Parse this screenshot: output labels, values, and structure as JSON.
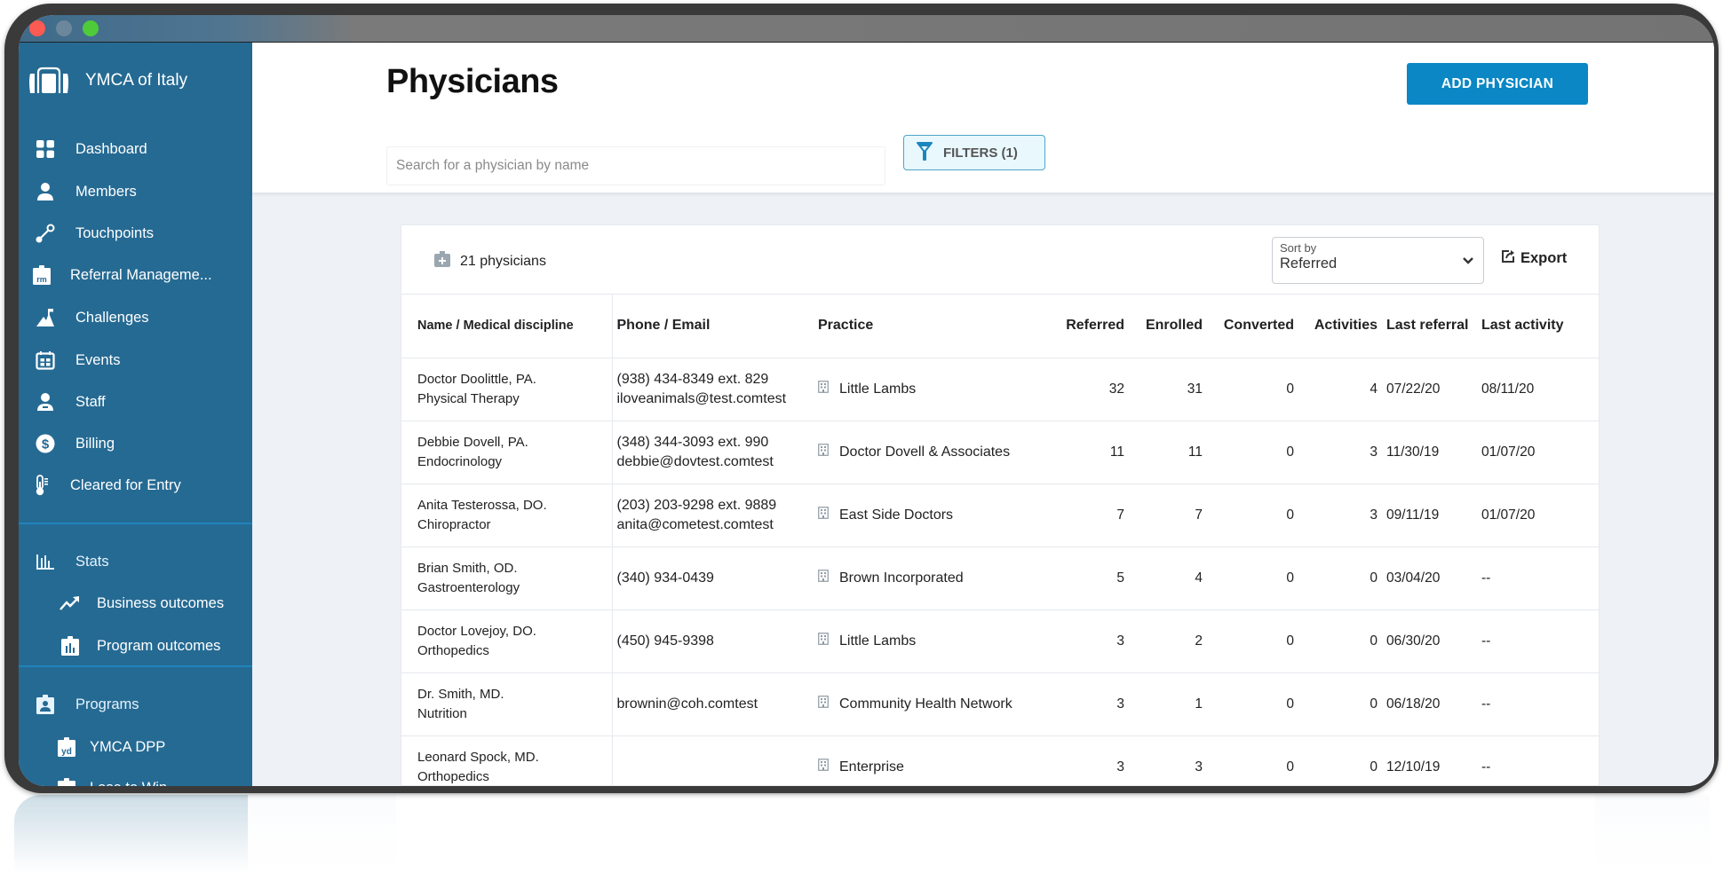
{
  "window": {
    "controls": [
      "close",
      "minimize",
      "zoom"
    ]
  },
  "sidebar": {
    "brand": "YMCA of Italy",
    "items": [
      {
        "label": "Dashboard",
        "icon": "dashboard-grid-icon"
      },
      {
        "label": "Members",
        "icon": "person-icon"
      },
      {
        "label": "Touchpoints",
        "icon": "touchpoints-link-icon"
      },
      {
        "label": "Referral Manageme...",
        "icon": "referral-management-rm-icon"
      },
      {
        "label": "Challenges",
        "icon": "mountain-flag-icon"
      },
      {
        "label": "Events",
        "icon": "calendar-icon"
      },
      {
        "label": "Staff",
        "icon": "staff-badge-icon"
      },
      {
        "label": "Billing",
        "icon": "dollar-circle-icon"
      },
      {
        "label": "Cleared for Entry",
        "icon": "thermometer-icon"
      }
    ],
    "stats": {
      "label": "Stats",
      "icon": "bar-chart-icon",
      "children": [
        {
          "label": "Business outcomes",
          "icon": "trend-up-icon"
        },
        {
          "label": "Program outcomes",
          "icon": "clipboard-chart-icon"
        }
      ]
    },
    "programs": {
      "label": "Programs",
      "icon": "clipboard-person-icon",
      "children": [
        {
          "label": "YMCA DPP",
          "icon": "clipboard-yd-icon"
        },
        {
          "label": "Lose to Win",
          "icon": "clipboard-lt-icon"
        }
      ]
    }
  },
  "header": {
    "title": "Physicians",
    "add_button": "ADD PHYSICIAN",
    "search_placeholder": "Search for a physician by name",
    "search_value": "",
    "filters_label": "FILTERS (1)"
  },
  "toolbar": {
    "count_label": "21 physicians",
    "sort_label": "Sort by",
    "sort_value": "Referred",
    "export_label": "Export"
  },
  "table": {
    "columns": [
      "Name / Medical discipline",
      "Phone / Email",
      "Practice",
      "Referred",
      "Enrolled",
      "Converted",
      "Activities",
      "Last referral",
      "Last activity"
    ],
    "rows": [
      {
        "name": "Doctor Doolittle, PA.",
        "discipline": "Physical Therapy",
        "phone": "(938) 434-8349 ext. 829",
        "email": "iloveanimals@test.comtest",
        "practice": "Little Lambs",
        "referred": "32",
        "enrolled": "31",
        "converted": "0",
        "activities": "4",
        "last_referral": "07/22/20",
        "last_activity": "08/11/20"
      },
      {
        "name": "Debbie Dovell, PA.",
        "discipline": "Endocrinology",
        "phone": "(348) 344-3093 ext. 990",
        "email": "debbie@dovtest.comtest",
        "practice": "Doctor Dovell & Associates",
        "referred": "11",
        "enrolled": "11",
        "converted": "0",
        "activities": "3",
        "last_referral": "11/30/19",
        "last_activity": "01/07/20"
      },
      {
        "name": "Anita Testerossa, DO.",
        "discipline": "Chiropractor",
        "phone": "(203) 203-9298 ext. 9889",
        "email": "anita@cometest.comtest",
        "practice": "East Side Doctors",
        "referred": "7",
        "enrolled": "7",
        "converted": "0",
        "activities": "3",
        "last_referral": "09/11/19",
        "last_activity": "01/07/20"
      },
      {
        "name": "Brian Smith, OD.",
        "discipline": "Gastroenterology",
        "phone": "(340) 934-0439",
        "email": "",
        "practice": "Brown Incorporated",
        "referred": "5",
        "enrolled": "4",
        "converted": "0",
        "activities": "0",
        "last_referral": "03/04/20",
        "last_activity": "--"
      },
      {
        "name": "Doctor Lovejoy, DO.",
        "discipline": "Orthopedics",
        "phone": "(450) 945-9398",
        "email": "",
        "practice": "Little Lambs",
        "referred": "3",
        "enrolled": "2",
        "converted": "0",
        "activities": "0",
        "last_referral": "06/30/20",
        "last_activity": "--"
      },
      {
        "name": "Dr. Smith, MD.",
        "discipline": "Nutrition",
        "phone": "",
        "email": "brownin@coh.comtest",
        "practice": "Community Health Network",
        "referred": "3",
        "enrolled": "1",
        "converted": "0",
        "activities": "0",
        "last_referral": "06/18/20",
        "last_activity": "--"
      },
      {
        "name": "Leonard Spock, MD.",
        "discipline": "Orthopedics",
        "phone": "",
        "email": "",
        "practice": "Enterprise",
        "referred": "3",
        "enrolled": "3",
        "converted": "0",
        "activities": "0",
        "last_referral": "12/10/19",
        "last_activity": "--"
      }
    ]
  },
  "colors": {
    "sidebar": "#256a93",
    "primary_button": "#0a87c4",
    "filters_bg": "#e9f8fd",
    "filters_border": "#4fa5c8",
    "page_bg": "#eef2f6"
  }
}
